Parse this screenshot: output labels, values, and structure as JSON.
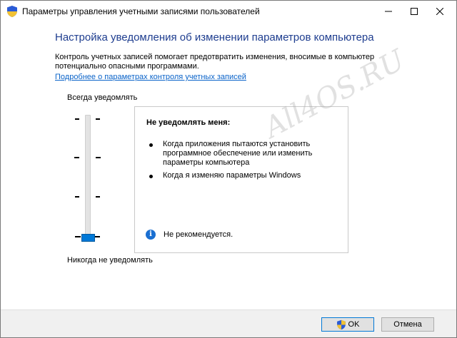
{
  "window": {
    "title": "Параметры управления учетными записями пользователей",
    "icon": "shield-icon"
  },
  "content": {
    "heading": "Настройка уведомления об изменении параметров компьютера",
    "description": "Контроль учетных записей помогает предотвратить изменения, вносимые в компьютер потенциально опасными программами.",
    "help_link": "Подробнее о параметрах контроля учетных записей"
  },
  "slider": {
    "top_label": "Всегда уведомлять",
    "bottom_label": "Никогда не уведомлять",
    "levels": 4,
    "selected_level": 1
  },
  "info_panel": {
    "title": "Не уведомлять меня:",
    "bullets": [
      "Когда приложения пытаются установить программное обеспечение или изменить параметры компьютера",
      "Когда я изменяю параметры Windows"
    ],
    "recommendation": "Не рекомендуется."
  },
  "buttons": {
    "ok": "OK",
    "cancel": "Отмена"
  },
  "watermark": "All4OS.RU",
  "colors": {
    "heading": "#1e3d8f",
    "link": "#0a63c9",
    "accent": "#0078d7",
    "info_icon": "#1a6fd1"
  }
}
